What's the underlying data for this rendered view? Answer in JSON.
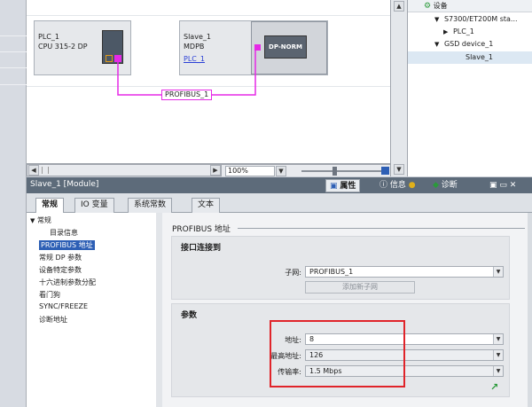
{
  "canvas": {
    "plc": {
      "name": "PLC_1",
      "type": "CPU 315-2 DP"
    },
    "slave": {
      "name": "Slave_1",
      "type": "MDPB",
      "master_link": "PLC_1",
      "module_label": "DP-NORM"
    },
    "bus_label": "PROFIBUS_1",
    "bus_color": "#e629e6",
    "zoom": "100%"
  },
  "tree": {
    "header": "设备",
    "items": [
      {
        "label": "S7300/ET200M sta...",
        "expand": "▼"
      },
      {
        "label": "PLC_1",
        "expand": "▶"
      },
      {
        "label": "GSD device_1",
        "expand": "▼"
      },
      {
        "label": "Slave_1",
        "expand": ""
      }
    ]
  },
  "properties": {
    "title": "Slave_1 [Module]",
    "tabs": {
      "props": "属性",
      "info": "信息",
      "diag": "诊断"
    },
    "general_tabs": [
      "常规",
      "IO 变量",
      "系统常数",
      "文本"
    ],
    "nav": {
      "group": "常规",
      "items": [
        "目录信息",
        "PROFIBUS 地址",
        "常规 DP 参数",
        "设备特定参数",
        "十六进制参数分配",
        "看门狗",
        "SYNC/FREEZE",
        "诊断地址"
      ]
    },
    "page_title": "PROFIBUS 地址",
    "interface": {
      "heading": "接口连接到",
      "subnet_label": "子网:",
      "subnet_value": "PROFIBUS_1",
      "add_subnet": "添加新子网"
    },
    "params": {
      "heading": "参数",
      "address_label": "地址:",
      "address_value": "8",
      "max_address_label": "最高地址:",
      "max_address_value": "126",
      "baud_label": "传输率:",
      "baud_value": "1.5 Mbps"
    }
  },
  "colors": {
    "highlight": "#e0242a",
    "accent": "#2a9a3a"
  }
}
